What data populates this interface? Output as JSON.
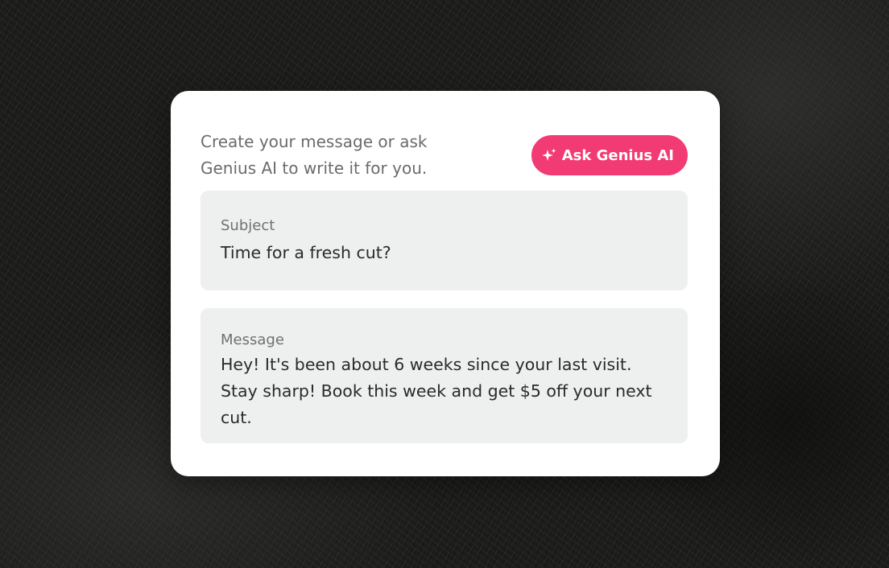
{
  "composer": {
    "intro_text": "Create your message or ask Genius AI to write it for you.",
    "ask_button": {
      "label": "Ask Genius AI",
      "icon": "sparkles-icon",
      "color": "#f23a74"
    },
    "subject": {
      "label": "Subject",
      "value": "Time for a fresh cut?"
    },
    "message": {
      "label": "Message",
      "value": "Hey! It's been about 6 weeks since your last visit. Stay sharp! Book this week and get $5 off your next cut."
    }
  }
}
